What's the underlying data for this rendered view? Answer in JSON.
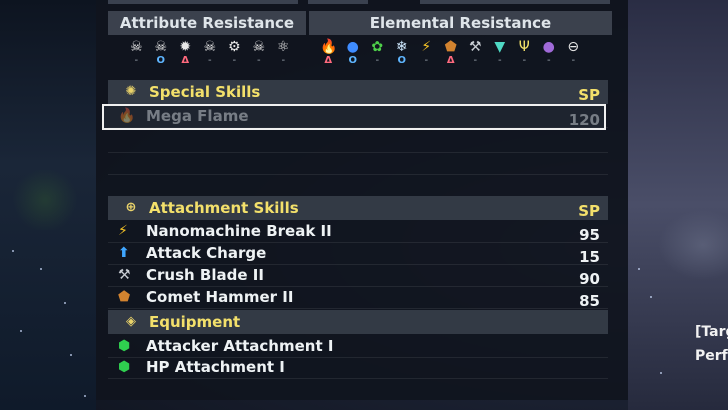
{
  "resistance": {
    "attribute_title": "Attribute Resistance",
    "elemental_title": "Elemental Resistance",
    "attribute_icons": [
      {
        "icon": "skull-icon",
        "glyph": "☠",
        "color": "#e8e8e8",
        "mark": "-"
      },
      {
        "icon": "skull-icon",
        "glyph": "☠",
        "color": "#e8e8e8",
        "mark": "O"
      },
      {
        "icon": "spiky-skull-icon",
        "glyph": "✹",
        "color": "#e8e8e8",
        "mark": "Δ"
      },
      {
        "icon": "skull-icon",
        "glyph": "☠",
        "color": "#e8e8e8",
        "mark": "-"
      },
      {
        "icon": "gear-icon",
        "glyph": "⚙",
        "color": "#e8e8e8",
        "mark": "-"
      },
      {
        "icon": "skull-icon",
        "glyph": "☠",
        "color": "#e8e8e8",
        "mark": "-"
      },
      {
        "icon": "atom-icon",
        "glyph": "⚛",
        "color": "#e8e8e8",
        "mark": "-"
      }
    ],
    "elemental_icons": [
      {
        "icon": "fire-icon",
        "glyph": "🔥",
        "color": "#ff5a2a",
        "mark": "Δ"
      },
      {
        "icon": "water-drop-icon",
        "glyph": "●",
        "color": "#3f8cff",
        "mark": "O"
      },
      {
        "icon": "plant-icon",
        "glyph": "✿",
        "color": "#4ed04a",
        "mark": "-"
      },
      {
        "icon": "ice-icon",
        "glyph": "❄",
        "color": "#cfe9ff",
        "mark": "O"
      },
      {
        "icon": "electric-icon",
        "glyph": "⚡",
        "color": "#f5c326",
        "mark": "-"
      },
      {
        "icon": "earth-icon",
        "glyph": "⬟",
        "color": "#d2832f",
        "mark": "Δ"
      },
      {
        "icon": "steel-icon",
        "glyph": "⚒",
        "color": "#c9ced4",
        "mark": "-"
      },
      {
        "icon": "wind-icon",
        "glyph": "▼",
        "color": "#4fd9c4",
        "mark": "-"
      },
      {
        "icon": "light-icon",
        "glyph": "Ψ",
        "color": "#f2e26a",
        "mark": "-"
      },
      {
        "icon": "dark-icon",
        "glyph": "●",
        "color": "#a06ad8",
        "mark": "-"
      },
      {
        "icon": "null-icon",
        "glyph": "⊖",
        "color": "#e8e8e8",
        "mark": "-"
      }
    ]
  },
  "special_skills": {
    "title": "Special Skills",
    "sp_label": "SP",
    "icon": "gear-icon",
    "items": [
      {
        "name": "Mega Flame",
        "sp": "120",
        "icon": "fire-icon",
        "color": "#ff5a2a"
      }
    ]
  },
  "attachment_skills": {
    "title": "Attachment Skills",
    "sp_label": "SP",
    "icon": "target-icon",
    "items": [
      {
        "name": "Nanomachine Break II",
        "sp": "95",
        "icon": "electric-icon",
        "color": "#f5c326"
      },
      {
        "name": "Attack Charge",
        "sp": "15",
        "icon": "buff-arrow-icon",
        "color": "#3fa6ff"
      },
      {
        "name": "Crush Blade II",
        "sp": "90",
        "icon": "steel-icon",
        "color": "#c9ced4"
      },
      {
        "name": "Comet Hammer II",
        "sp": "85",
        "icon": "earth-icon",
        "color": "#d2832f"
      }
    ]
  },
  "equipment": {
    "title": "Equipment",
    "icon": "diamond-icon",
    "items": [
      {
        "name": "Attacker Attachment I",
        "icon": "green-gem-icon",
        "color": "#2fcf4f"
      },
      {
        "name": "HP Attachment I",
        "icon": "green-gem-icon",
        "color": "#2fcf4f"
      }
    ]
  },
  "side_hint": {
    "line1": "[Targ",
    "line2": "Perfo"
  }
}
